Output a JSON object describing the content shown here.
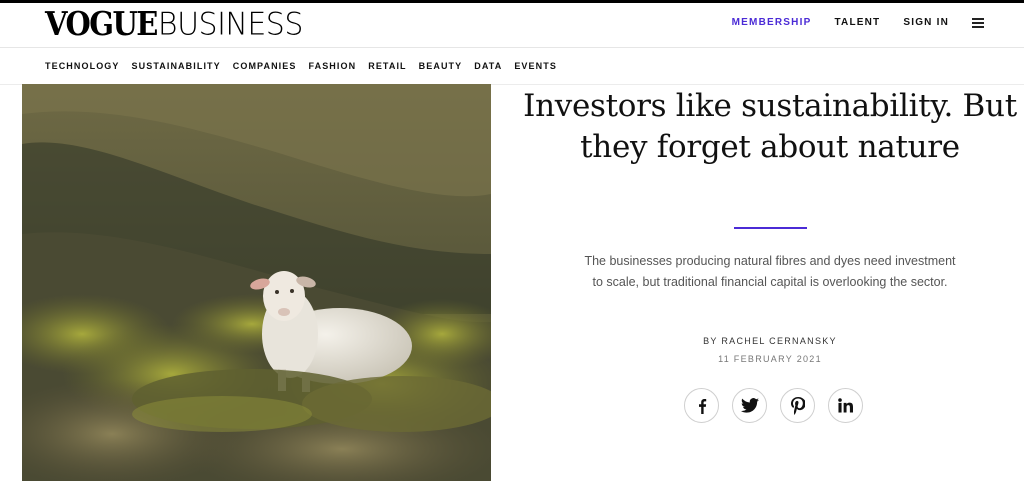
{
  "logo": {
    "part1": "VOGUE",
    "part2": "BUSINESS"
  },
  "header": {
    "membership": "MEMBERSHIP",
    "talent": "TALENT",
    "signin": "SIGN IN",
    "menu_icon": "hamburger-menu-icon"
  },
  "nav": {
    "items": [
      "TECHNOLOGY",
      "SUSTAINABILITY",
      "COMPANIES",
      "FASHION",
      "RETAIL",
      "BEAUTY",
      "DATA",
      "EVENTS"
    ]
  },
  "article": {
    "headline": "Investors like sustainability. But they forget about nature",
    "dek": "The businesses producing natural fibres and dyes need investment to scale, but traditional financial capital is overlooking the sector.",
    "byline": "BY RACHEL CERNANSKY",
    "date": "11 FEBRUARY 2021"
  },
  "share": {
    "icons": [
      "facebook-icon",
      "twitter-icon",
      "pinterest-icon",
      "linkedin-icon"
    ]
  },
  "colors": {
    "accent": "#4b2bd6",
    "text": "#111111",
    "muted": "#555555"
  }
}
